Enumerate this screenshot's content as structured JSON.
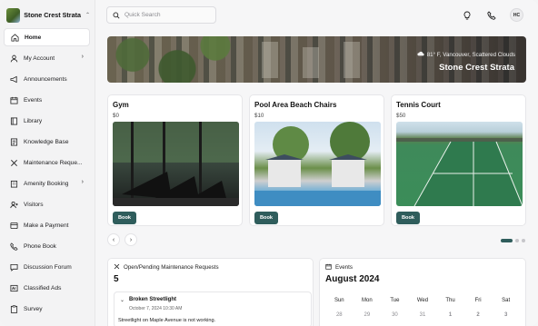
{
  "org": {
    "name": "Stone Crest Strata"
  },
  "sidebar": {
    "items": [
      {
        "label": "Home",
        "active": true
      },
      {
        "label": "My Account",
        "caret": true
      },
      {
        "label": "Announcements"
      },
      {
        "label": "Events"
      },
      {
        "label": "Library"
      },
      {
        "label": "Knowledge Base"
      },
      {
        "label": "Maintenance Reque..."
      },
      {
        "label": "Amenity Booking",
        "caret": true
      },
      {
        "label": "Visitors"
      },
      {
        "label": "Make a Payment"
      },
      {
        "label": "Phone Book"
      },
      {
        "label": "Discussion Forum"
      },
      {
        "label": "Classified Ads"
      },
      {
        "label": "Survey"
      }
    ]
  },
  "search": {
    "placeholder": "Quick Search"
  },
  "header": {
    "avatar_initials": "HC"
  },
  "hero": {
    "weather": "81° F, Vancouver, Scattered Clouds",
    "title": "Stone Crest Strata"
  },
  "amenities": [
    {
      "title": "Gym",
      "price": "$0",
      "button": "Book"
    },
    {
      "title": "Pool Area Beach Chairs",
      "price": "$10",
      "button": "Book"
    },
    {
      "title": "Tennis Court",
      "price": "$50",
      "button": "Book"
    }
  ],
  "carousel": {
    "prev": "‹",
    "next": "›"
  },
  "maintenance": {
    "heading": "Open/Pending Maintenance Requests",
    "count": "5",
    "item": {
      "title": "Broken Streetlight",
      "date": "October 7, 2024 10:30 AM",
      "description": "Streetlight on Maple Avenue is not working."
    }
  },
  "events": {
    "heading": "Events",
    "month": "August 2024",
    "days": [
      "Sun",
      "Mon",
      "Tue",
      "Wed",
      "Thu",
      "Fri",
      "Sat"
    ],
    "first_week": [
      "28",
      "29",
      "30",
      "31",
      "1",
      "2",
      "3"
    ]
  },
  "colors": {
    "accent": "#2f5d5c",
    "sidebar_bg": "#f3f3f4",
    "page_bg": "#f6f6f7"
  }
}
